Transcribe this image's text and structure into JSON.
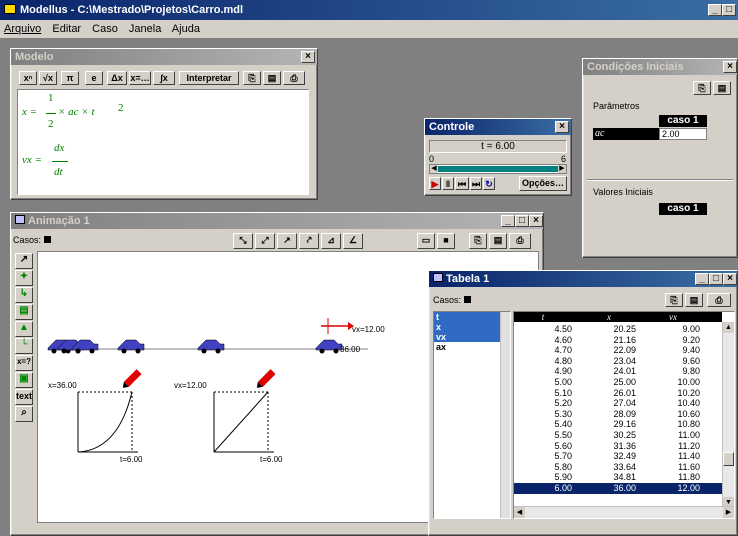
{
  "app": {
    "title": "Modellus - C:\\Mestrado\\Projetos\\Carro.mdl"
  },
  "menu": [
    "Arquivo",
    "Editar",
    "Caso",
    "Janela",
    "Ajuda"
  ],
  "modelo": {
    "title": "Modelo",
    "toolbar": [
      "xⁿ",
      "√x",
      "π",
      "e",
      "Δx",
      "x=…",
      "Interpretar"
    ],
    "eq1": {
      "lhs": "x =",
      "num": "1",
      "den": "2",
      "rhs": "× ac × t",
      "exp": "2"
    },
    "eq2": {
      "lhs": "vx =",
      "num": "dx",
      "den": "dt"
    }
  },
  "controle": {
    "title": "Controle",
    "time_label": "t = 6.00",
    "min": "0",
    "max": "6",
    "options_label": "Opções…"
  },
  "condicoes": {
    "title": "Condições Iniciais",
    "params_label": "Parâmetros",
    "case_header": "caso 1",
    "param_name": "ac",
    "param_value": "2.00",
    "initial_label": "Valores Iniciais",
    "case_header2": "caso 1"
  },
  "animacao": {
    "title": "Animação 1",
    "cases_label": "Casos:",
    "tools": [
      "↗",
      "✦",
      "↳",
      "▤",
      "▲",
      "└",
      "x=?",
      "▣",
      "text",
      "⌕"
    ],
    "vector_label": "vx=12.00",
    "pos_label": "36.00",
    "graph1": {
      "y_label": "x=36.00",
      "x_label": "t=6.00"
    },
    "graph2": {
      "y_label": "vx=12.00",
      "x_label": "t=6.00"
    }
  },
  "tabela": {
    "title": "Tabela 1",
    "cases_label": "Casos:",
    "vars": [
      "t",
      "x",
      "vx",
      "ax"
    ],
    "headers": [
      "t",
      "x",
      "vx"
    ],
    "rows": [
      [
        "4.50",
        "20.25",
        "9.00"
      ],
      [
        "4.60",
        "21.16",
        "9.20"
      ],
      [
        "4.70",
        "22.09",
        "9.40"
      ],
      [
        "4.80",
        "23.04",
        "9.60"
      ],
      [
        "4.90",
        "24.01",
        "9.80"
      ],
      [
        "5.00",
        "25.00",
        "10.00"
      ],
      [
        "5.10",
        "26.01",
        "10.20"
      ],
      [
        "5.20",
        "27.04",
        "10.40"
      ],
      [
        "5.30",
        "28.09",
        "10.60"
      ],
      [
        "5.40",
        "29.16",
        "10.80"
      ],
      [
        "5.50",
        "30.25",
        "11.00"
      ],
      [
        "5.60",
        "31.36",
        "11.20"
      ],
      [
        "5.70",
        "32.49",
        "11.40"
      ],
      [
        "5.80",
        "33.64",
        "11.60"
      ],
      [
        "5.90",
        "34.81",
        "11.80"
      ],
      [
        "6.00",
        "36.00",
        "12.00"
      ]
    ],
    "selected_row": 15
  },
  "colors": {
    "titlebar": "#0a246a",
    "equation": "#008000",
    "vector": "#e00000",
    "selected": "#0a246a"
  }
}
